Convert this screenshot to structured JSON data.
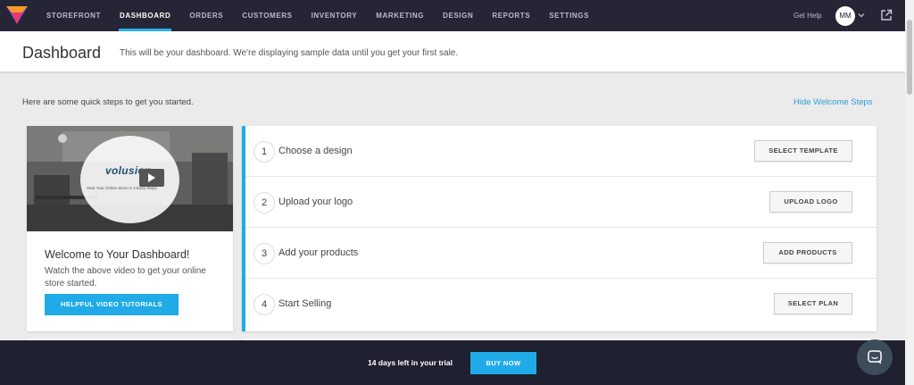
{
  "nav": {
    "items": [
      "STOREFRONT",
      "DASHBOARD",
      "ORDERS",
      "CUSTOMERS",
      "INVENTORY",
      "MARKETING",
      "DESIGN",
      "REPORTS",
      "SETTINGS"
    ],
    "active": "DASHBOARD",
    "get_help": "Get Help",
    "avatar_initials": "MM",
    "logo_icon": "volusion-v-logo",
    "external_icon": "external-link-icon"
  },
  "header": {
    "title": "Dashboard",
    "subtitle": "This will be your dashboard. We're displaying sample data until you get your first sale."
  },
  "intro": {
    "text": "Here are some quick steps to get you started.",
    "hide_link": "Hide Welcome Steps"
  },
  "welcome": {
    "video_brand": "volusion",
    "video_caption": "Start Your Online Store In 4 Easy Steps",
    "title": "Welcome to Your Dashboard!",
    "text": "Watch the above video to get your online store started.",
    "button": "HELPFUL VIDEO TUTORIALS"
  },
  "steps": [
    {
      "num": "1",
      "label": "Choose a design",
      "button": "SELECT TEMPLATE"
    },
    {
      "num": "2",
      "label": "Upload your logo",
      "button": "UPLOAD LOGO"
    },
    {
      "num": "3",
      "label": "Add your products",
      "button": "ADD PRODUCTS"
    },
    {
      "num": "4",
      "label": "Start Selling",
      "button": "SELECT PLAN"
    }
  ],
  "trial": {
    "text": "14 days left in your trial",
    "button": "BUY NOW"
  },
  "colors": {
    "nav_bg": "#252536",
    "accent": "#20abe8",
    "trial_bg": "#1f2130"
  }
}
